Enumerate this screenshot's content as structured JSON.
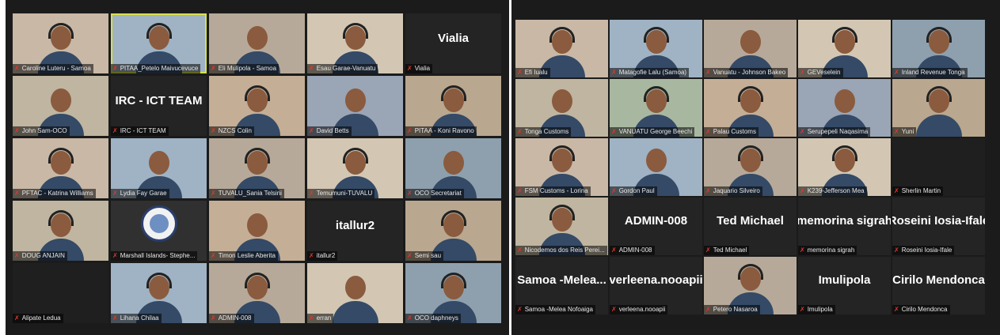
{
  "colors": {
    "grid_bg": "#1b1b1b",
    "label_bg": "rgba(0,0,0,0.55)",
    "muted_mic": "#e0392b",
    "active_speaker": "#d8e04a"
  },
  "left_panel": {
    "tiles": [
      {
        "label": "Caroline Luteru - Samoa"
      },
      {
        "label": "PITAA_Petelo Maivucevuce"
      },
      {
        "label": "Eli Mulipola - Samoa"
      },
      {
        "label": "Esau Garae-Vanuatu"
      },
      {
        "label": "Vialia",
        "name_display": "Vialia"
      },
      {
        "label": "John Sam-OCO"
      },
      {
        "label": "IRC - ICT TEAM",
        "name_display": "IRC - ICT TEAM"
      },
      {
        "label": "NZCS Colin"
      },
      {
        "label": "David Betts"
      },
      {
        "label": "PITAA - Koni Ravono"
      },
      {
        "label": "PFTAC - Katrina Williams"
      },
      {
        "label": "Lydia Fay Garae"
      },
      {
        "label": "TUVALU_Sania Telsini"
      },
      {
        "label": "Temumuni-TUVALU"
      },
      {
        "label": "OCO Secretariat"
      },
      {
        "label": "DOUG ANJAIN"
      },
      {
        "label": "Marshall Islands- Stephe..."
      },
      {
        "label": "Timon Leslie Aberita"
      },
      {
        "label": "itallur2",
        "name_display": "itallur2"
      },
      {
        "label": "Semi sau"
      },
      {
        "label": "Alipate Ledua"
      },
      {
        "label": "Lihana Chilaa"
      },
      {
        "label": "ADMIN-008"
      },
      {
        "label": "erran"
      },
      {
        "label": "OCO daphneys"
      }
    ]
  },
  "right_panel": {
    "tiles": [
      {
        "label": "Efi Iualu"
      },
      {
        "label": "Matagofie Lalu (Samoa)"
      },
      {
        "label": "Vanuatu - Johnson Bakeo"
      },
      {
        "label": "GEVeselein"
      },
      {
        "label": "Inland Revenue Tonga"
      },
      {
        "label": "Tonga Customs"
      },
      {
        "label": "VANUATU George Beechi"
      },
      {
        "label": "Palau Customs"
      },
      {
        "label": "Serupepeli Naqasima"
      },
      {
        "label": "Yuni"
      },
      {
        "label": "FSM Customs - Lorina"
      },
      {
        "label": "Gordon Paul"
      },
      {
        "label": "Jaquario Silveiro"
      },
      {
        "label": "K239-Jefferson Mea"
      },
      {
        "label": "Sherlin Martin"
      },
      {
        "label": "Nicodemos dos Reis Perei..."
      },
      {
        "label": "ADMIN-008",
        "name_display": "ADMIN-008"
      },
      {
        "label": "Ted Michael",
        "name_display": "Ted Michael"
      },
      {
        "label": "memorina sigrah",
        "name_display": "memorina sigrah"
      },
      {
        "label": "Roseini Iosia-Ifale",
        "name_display": "Roseini Iosia-Ifale"
      },
      {
        "label": "Samoa -Melea Nofoaiga",
        "name_display": "Samoa -Melea..."
      },
      {
        "label": "verleena.nooapii",
        "name_display": "verleena.nooapii"
      },
      {
        "label": "Petero Nasaroa"
      },
      {
        "label": "Imulipola",
        "name_display": "Imulipola"
      },
      {
        "label": "Cirilo Mendonca",
        "name_display": "Cirilo Mendonca"
      }
    ]
  }
}
